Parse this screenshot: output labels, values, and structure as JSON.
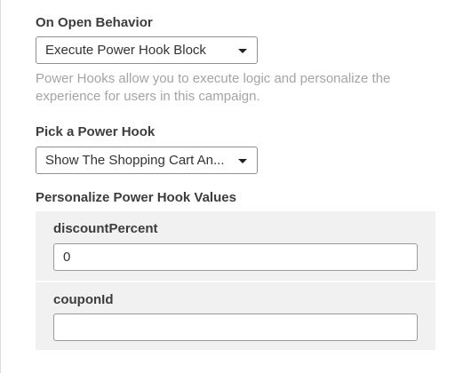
{
  "on_open": {
    "label": "On Open Behavior",
    "selected": "Execute Power Hook Block"
  },
  "help_text": "Power Hooks allow you to execute logic and personalize the experience for users in this campaign.",
  "power_hook": {
    "label": "Pick a Power Hook",
    "selected": "Show The Shopping Cart An..."
  },
  "personalize": {
    "label": "Personalize Power Hook Values",
    "fields": [
      {
        "name": "discountPercent",
        "value": "0"
      },
      {
        "name": "couponId",
        "value": ""
      }
    ]
  }
}
